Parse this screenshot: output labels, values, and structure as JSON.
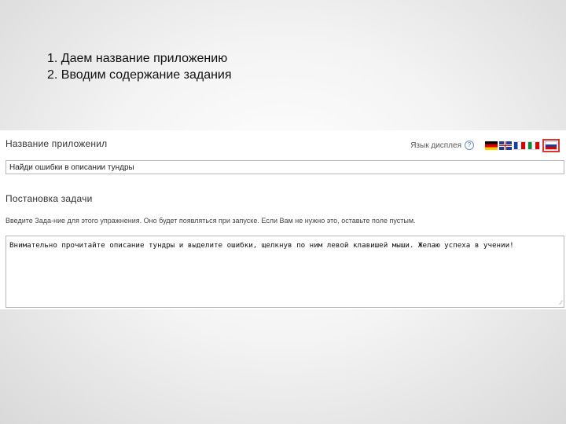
{
  "instructions": {
    "line1": "1. Даем название приложению",
    "line2": "2. Вводим содержание задания"
  },
  "form": {
    "app_name_label": "Название приложенил",
    "language_label": "Язык дисплея",
    "languages": [
      "de",
      "en",
      "fr",
      "it",
      "ru"
    ],
    "selected_language": "ru",
    "title_value": "Найди ошибки в описании тундры",
    "task_heading": "Постановка задачи",
    "task_hint": "Введите Зада-ние для этого упражнения. Оно будет появляться при запуске. Если Вам не нужно это, оставьте поле пустым.",
    "task_text": "Внимательно прочитайте описание тундры и выделите ошибки, щелкнув по ним левой клавишей мыши. Желаю успеха в учении!"
  },
  "colors": {
    "selected_flag_border": "#d33333"
  }
}
